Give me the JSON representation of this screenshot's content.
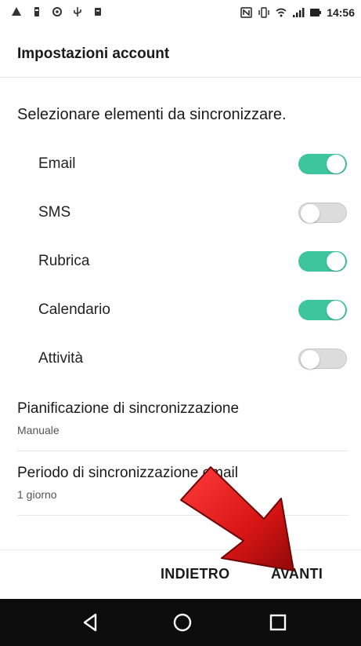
{
  "status_bar": {
    "time": "14:56",
    "left_icons": [
      "alert-icon",
      "battery-saver-icon",
      "sync-icon",
      "usb-icon",
      "download-icon"
    ],
    "right_icons": [
      "nfc-icon",
      "vibrate-icon",
      "wifi-icon",
      "signal-icon",
      "battery-icon"
    ]
  },
  "header": {
    "title": "Impostazioni account"
  },
  "section_label": "Selezionare elementi da sincronizzare.",
  "sync_items": [
    {
      "label": "Email",
      "enabled": true
    },
    {
      "label": "SMS",
      "enabled": false
    },
    {
      "label": "Rubrica",
      "enabled": true
    },
    {
      "label": "Calendario",
      "enabled": true
    },
    {
      "label": "Attività",
      "enabled": false
    }
  ],
  "schedule": {
    "title": "Pianificazione di sincronizzazione",
    "value": "Manuale"
  },
  "period": {
    "title": "Periodo di sincronizzazione email",
    "value": "1 giorno"
  },
  "actions": {
    "back_label": "INDIETRO",
    "next_label": "AVANTI"
  },
  "nav": {
    "icons": [
      "back-icon",
      "home-icon",
      "recent-apps-icon"
    ]
  },
  "colors": {
    "toggle_on": "#3dc59e",
    "toggle_off": "#dcdcdc",
    "arrow": "#d81515",
    "nav_bar": "#0d0d0d"
  }
}
